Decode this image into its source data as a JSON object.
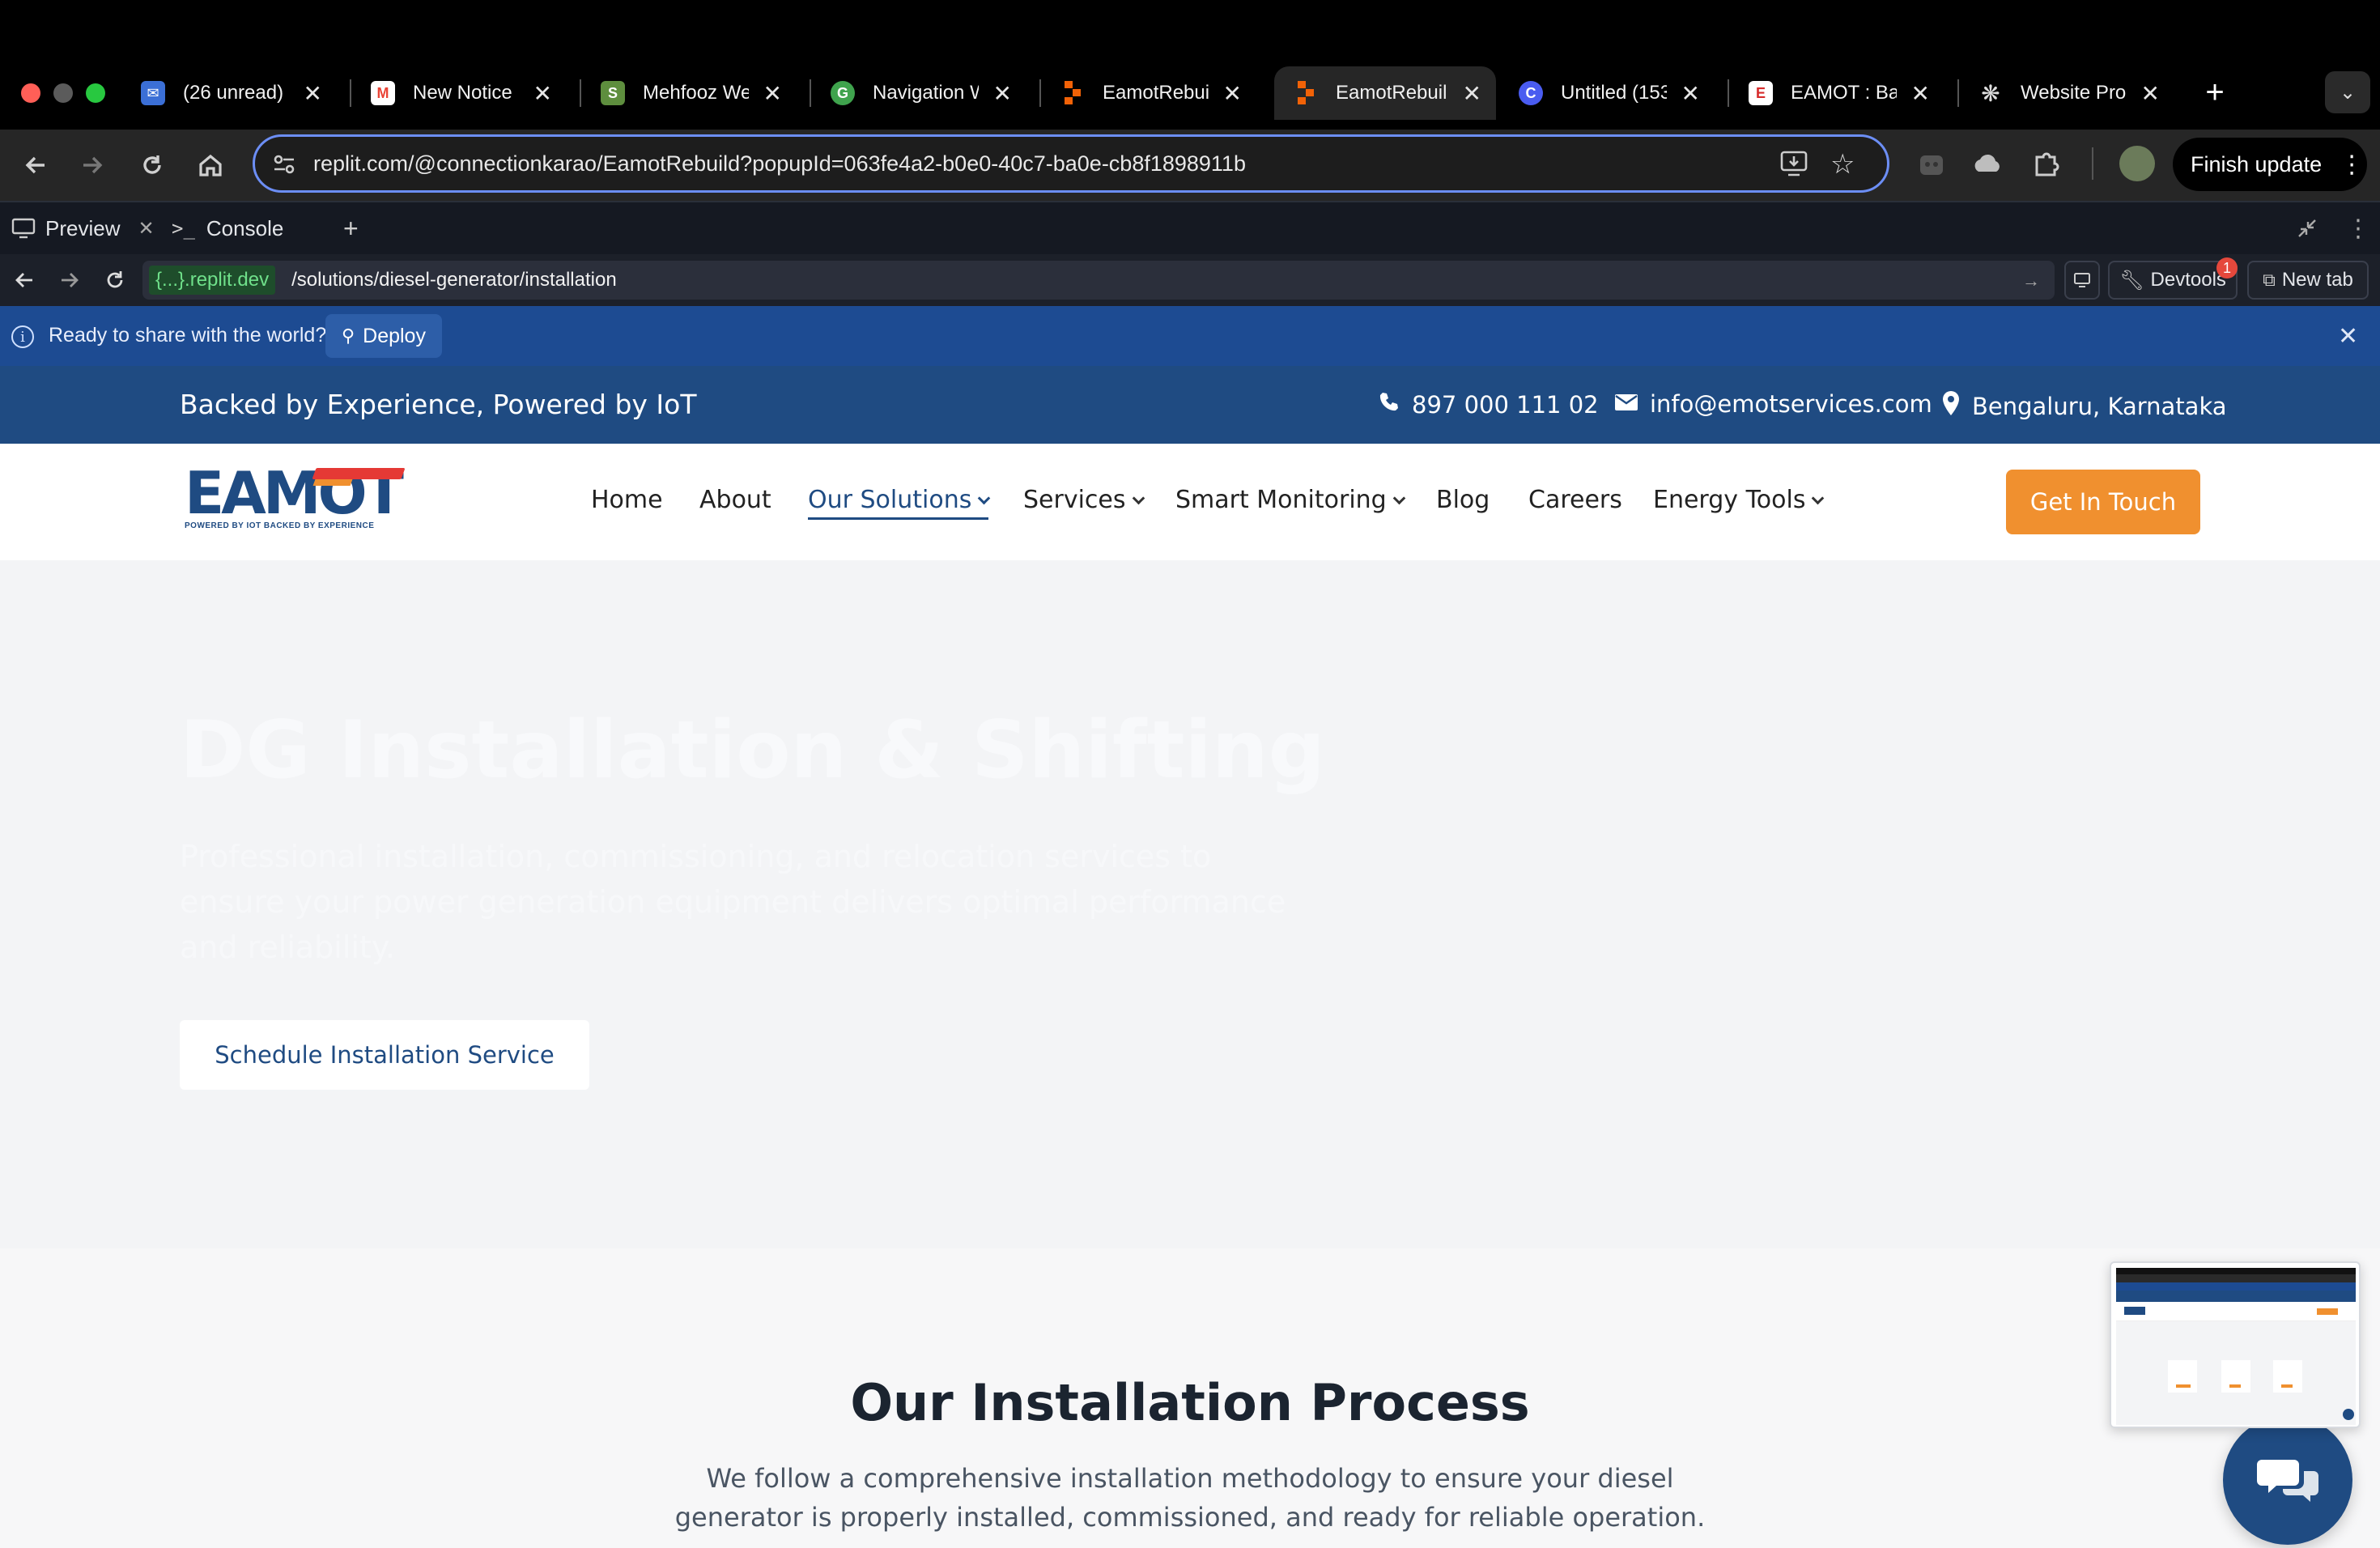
{
  "browser": {
    "tabs": [
      {
        "title": "(26 unread)",
        "icon": "mail-inbox-icon",
        "color": "#3b6fd6"
      },
      {
        "title": "New Notice",
        "icon": "gmail-icon",
        "color": "#ea4335"
      },
      {
        "title": "Mehfooz We",
        "icon": "shopify-icon",
        "color": "#5e8e3e"
      },
      {
        "title": "Navigation W",
        "icon": "navigation-app-icon",
        "color": "#3fa34d"
      },
      {
        "title": "EamotRebuil",
        "icon": "replit-icon",
        "color": "#f26207"
      },
      {
        "title": "EamotRebuil",
        "icon": "replit-icon",
        "color": "#f26207"
      },
      {
        "title": "Untitled (153",
        "icon": "canva-icon",
        "color": "#4a5cf0"
      },
      {
        "title": "EAMOT : Bac",
        "icon": "eamot-site-icon",
        "color": "#d62b2b"
      },
      {
        "title": "Website Pro",
        "icon": "openai-icon",
        "color": "#cccccc"
      }
    ],
    "url": "replit.com/@connectionkarao/EamotRebuild?popupId=063fe4a2-b0e0-40c7-ba0e-cb8f1898911b",
    "finish_update": "Finish update"
  },
  "replit": {
    "tab_preview": "Preview",
    "tab_console": "Console",
    "url_prefix": "{...}.replit.dev",
    "url_path": "/solutions/diesel-generator/installation",
    "devtools_label": "Devtools",
    "devtools_badge": "1",
    "new_tab_label": "New tab",
    "banner_text": "Ready to share with the world?",
    "deploy_label": "Deploy"
  },
  "site": {
    "tagline": "Backed by Experience, Powered by IoT",
    "phone": "897 000 111 02",
    "email": "info@emotservices.com",
    "location": "Bengaluru, Karnataka",
    "logo_text": "EAMOT",
    "logo_sub": "POWERED BY IOT BACKED BY EXPERIENCE",
    "nav": {
      "home": "Home",
      "about": "About",
      "solutions": "Our Solutions",
      "services": "Services",
      "monitoring": "Smart Monitoring",
      "blog": "Blog",
      "careers": "Careers",
      "tools": "Energy Tools"
    },
    "cta": "Get In Touch",
    "hero": {
      "title": "DG Installation & Shifting",
      "desc": "Professional installation, commissioning, and relocation services to ensure your power generation equipment delivers optimal performance and reliability.",
      "button": "Schedule Installation Service"
    },
    "process": {
      "title": "Our Installation Process",
      "desc": "We follow a comprehensive installation methodology to ensure your diesel generator is properly installed, commissioned, and ready for reliable operation."
    }
  },
  "colors": {
    "brand_blue": "#1f4b82",
    "accent_orange": "#f0902f",
    "banner_blue": "#1d4b92"
  }
}
